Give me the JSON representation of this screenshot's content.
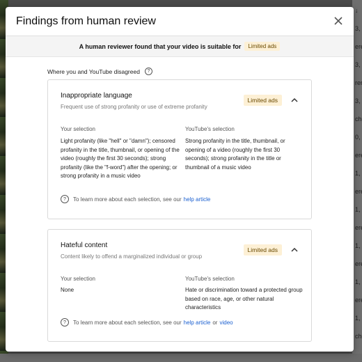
{
  "background_right_snippets": [
    "↓",
    "3, 2",
    "ere",
    "3, 2",
    "rere",
    "3, 2",
    "che",
    "0, 2",
    "ere",
    "1, 2",
    "ere",
    "1, 2",
    "ere",
    "1, 2",
    "ere",
    "1, 2",
    "ere",
    "1, 2",
    "che"
  ],
  "dialog": {
    "title": "Findings from human review",
    "close_icon": "close-icon"
  },
  "banner": {
    "text": "A human reviewer found that your video is suitable for",
    "badge": "Limited ads"
  },
  "disagree_label": "Where you and YouTube disagreed",
  "help_glyph": "?",
  "cards": [
    {
      "title": "Inappropriate language",
      "subtitle": "Frequent use of strong profanity or use of extreme profanity",
      "badge": "Limited ads",
      "your_label": "Your selection",
      "your_text": "Light profanity (like \"hell\" or \"damn\"); censored profanity in the title, thumbnail, or opening of the video (roughly the first 30 seconds); strong profanity (like the \"f-word\") after the opening; or strong profanity in a music video",
      "yt_label": "YouTube's selection",
      "yt_text": "Strong profanity in the title, thumbnail, or opening of a video (roughly the first 30 seconds); strong profanity in the title or thumbnail of a music video",
      "info_text": "To learn more about each selection, see our",
      "link1": "help article"
    },
    {
      "title": "Hateful content",
      "subtitle": "Content likely to offend a marginalized individual or group",
      "badge": "Limited ads",
      "your_label": "Your selection",
      "your_text": "None",
      "yt_label": "YouTube's selection",
      "yt_text": "Hate or discrimination toward a protected group based on race, age, or other natural characteristics",
      "info_text": "To learn more about each selection, see our",
      "link1": "help article",
      "or": "or",
      "link2": "video"
    }
  ]
}
